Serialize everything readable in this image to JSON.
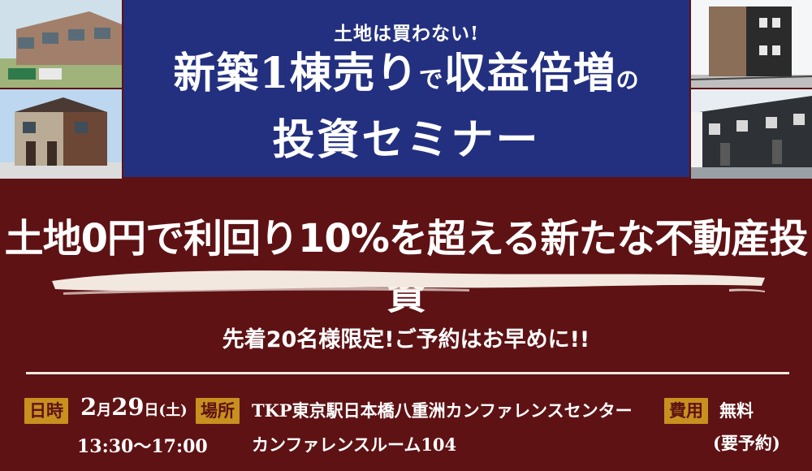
{
  "header": {
    "kicker": "土地は買わない!",
    "headline_a": "新築1棟売り",
    "headline_de": "で",
    "headline_b": "収益倍増",
    "headline_no": "の",
    "subhead": "投資セミナー"
  },
  "tagline": "土地0円で利回り10%を超える新たな不動産投資",
  "notice": "先着20名様限定!ご予約はお早めに!!",
  "info": {
    "date_label": "日時",
    "date_month": "2",
    "date_month_unit": "月",
    "date_day": "29",
    "date_day_unit": "日",
    "date_weekday": "(土)",
    "time": "13:30～17:00",
    "place_label": "場所",
    "place_line1": "TKP東京駅日本橋八重洲カンファレンスセンター",
    "place_line2": "カンファレンスルーム104",
    "fee_label": "費用",
    "fee_line1": "無料",
    "fee_line2": "(要予約)"
  },
  "colors": {
    "background": "#5e1214",
    "panel": "#233080",
    "label": "#c8901f",
    "text": "#ffffff"
  }
}
